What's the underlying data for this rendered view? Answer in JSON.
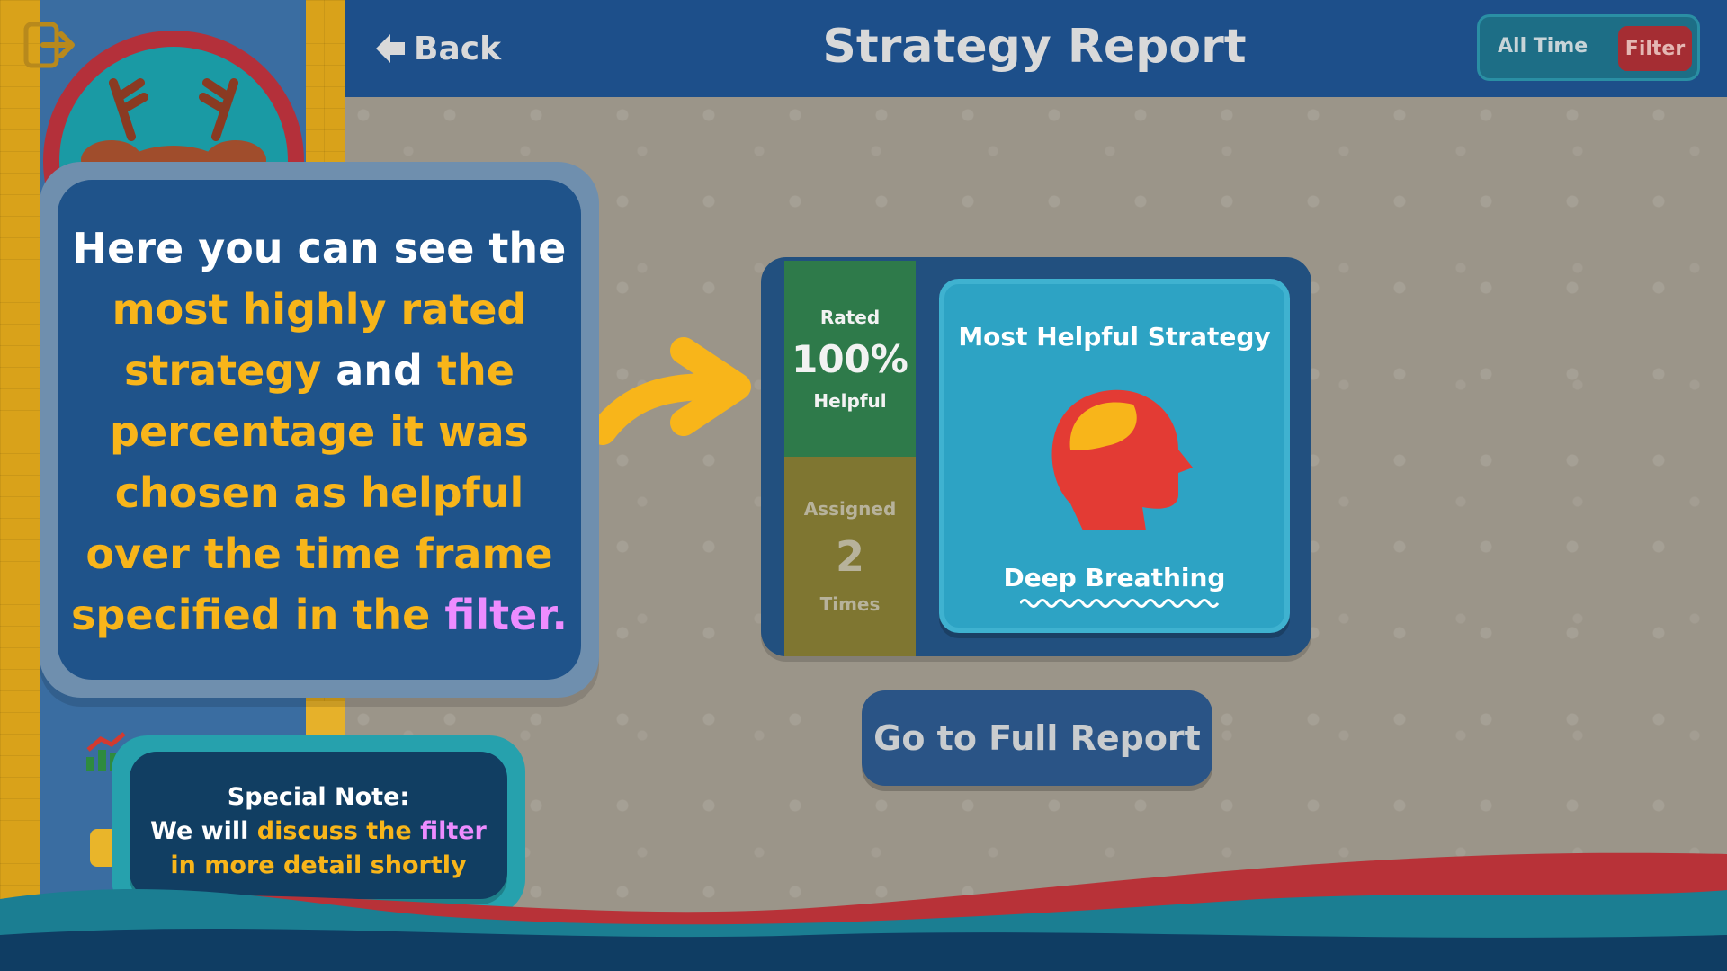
{
  "header": {
    "back_label": "Back",
    "title": "Strategy Report",
    "timeframe_label": "All Time",
    "filter_label": "Filter"
  },
  "strategy": {
    "rated_label": "Rated",
    "rated_value": "100%",
    "helpful_label": "Helpful",
    "assigned_label": "Assigned",
    "assigned_value": "2",
    "times_label": "Times",
    "tile_heading": "Most Helpful Strategy",
    "name": "Deep Breathing",
    "full_report_label": "Go to Full Report"
  },
  "tutorial": {
    "part1": "Here you can see the",
    "part2": "most highly rated strategy",
    "part3": "and",
    "part4": "the percentage it was chosen as helpful over the time frame specified in the",
    "part5": "filter."
  },
  "note": {
    "title": "Special Note:",
    "line_start": "We will",
    "highlight_yellow": "discuss the",
    "highlight_pink": "filter",
    "line_end": "in more detail shortly"
  },
  "icons": {
    "exit": "exit-icon",
    "back": "back-arrow-icon",
    "head": "head-icon",
    "chart": "chart-icon",
    "arrow": "pointer-arrow-icon"
  },
  "colors": {
    "header": "#1d4f8a",
    "callout": "#1f538a",
    "highlight_yellow": "#f8b51a",
    "highlight_pink": "#ed8cff",
    "rated_panel": "#2e7a4a",
    "tile": "#2da3c4",
    "filter": "#a52d33"
  }
}
